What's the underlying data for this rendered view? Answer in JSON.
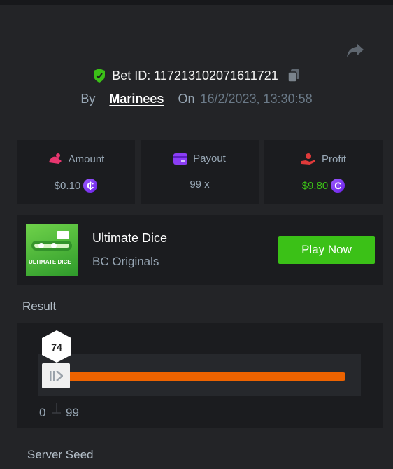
{
  "header": {
    "bet_label": "Bet ID: 117213102071611721",
    "by_label": "By",
    "username": "Marinees",
    "on_label": "On",
    "date": "16/2/2023, 13:30:58"
  },
  "stats": {
    "amount": {
      "label": "Amount",
      "value": "$0.10"
    },
    "payout": {
      "label": "Payout",
      "value": "99 x"
    },
    "profit": {
      "label": "Profit",
      "value": "$9.80"
    }
  },
  "game": {
    "title": "Ultimate Dice",
    "subtitle": "BC Originals",
    "play_label": "Play Now",
    "thumb_text": "ULTIMATE DICE"
  },
  "result": {
    "label": "Result",
    "value": "74",
    "range_min": "0",
    "range_max": "99"
  },
  "server_seed": {
    "label": "Server Seed"
  },
  "colors": {
    "accent_green": "#3bc117",
    "bar_orange": "#ed6300",
    "coin_purple": "#7a3cf0"
  }
}
